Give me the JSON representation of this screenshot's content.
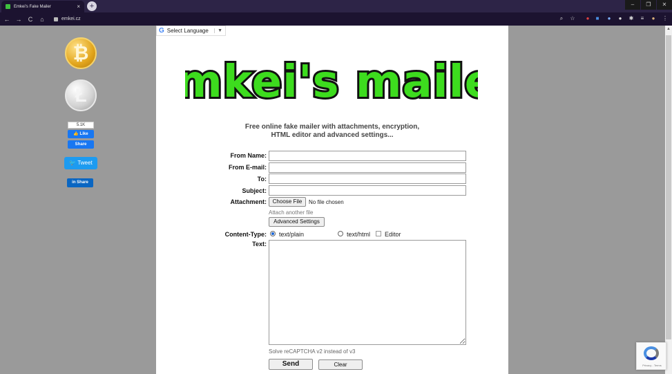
{
  "browser": {
    "tab_title": "Emkei's Fake Mailer",
    "tab_close": "×",
    "new_tab": "+",
    "url": "emkei.cz",
    "nav": {
      "back": "←",
      "forward": "→",
      "reload": "C",
      "home": "⌂"
    },
    "window": {
      "minimize": "–",
      "restore": "❐",
      "close": "✕"
    }
  },
  "translate": {
    "g": "G",
    "label": "Select Language",
    "caret": "▼"
  },
  "sidebar": {
    "btc_symbol": "₿",
    "ltc_symbol": "Ł",
    "fb_count": "5.1K",
    "fb_like": "👍 Like",
    "fb_share": "Share",
    "tweet": "🐦 Tweet",
    "linkedin": "in Share"
  },
  "logo": {
    "text": "Emkei's mailer",
    "fill": "#3ddc1e",
    "stroke": "#111111"
  },
  "subtitle": {
    "line1": "Free online fake mailer with attachments, encryption,",
    "line2": "HTML editor and advanced settings..."
  },
  "form": {
    "from_name_label": "From Name:",
    "from_email_label": "From E-mail:",
    "to_label": "To:",
    "subject_label": "Subject:",
    "attachment_label": "Attachment:",
    "choose_file": "Choose File",
    "no_file": "No file chosen",
    "attach_another": "Attach another file",
    "advanced_settings": "Advanced Settings",
    "content_type_label": "Content-Type:",
    "text_plain": "text/plain",
    "text_html": "text/html",
    "editor": "Editor",
    "text_label": "Text:",
    "recaptcha_note": "Solve reCAPTCHA v2 instead of v3",
    "send": "Send",
    "clear": "Clear"
  },
  "recaptcha": {
    "footer": "Privacy - Terms"
  }
}
